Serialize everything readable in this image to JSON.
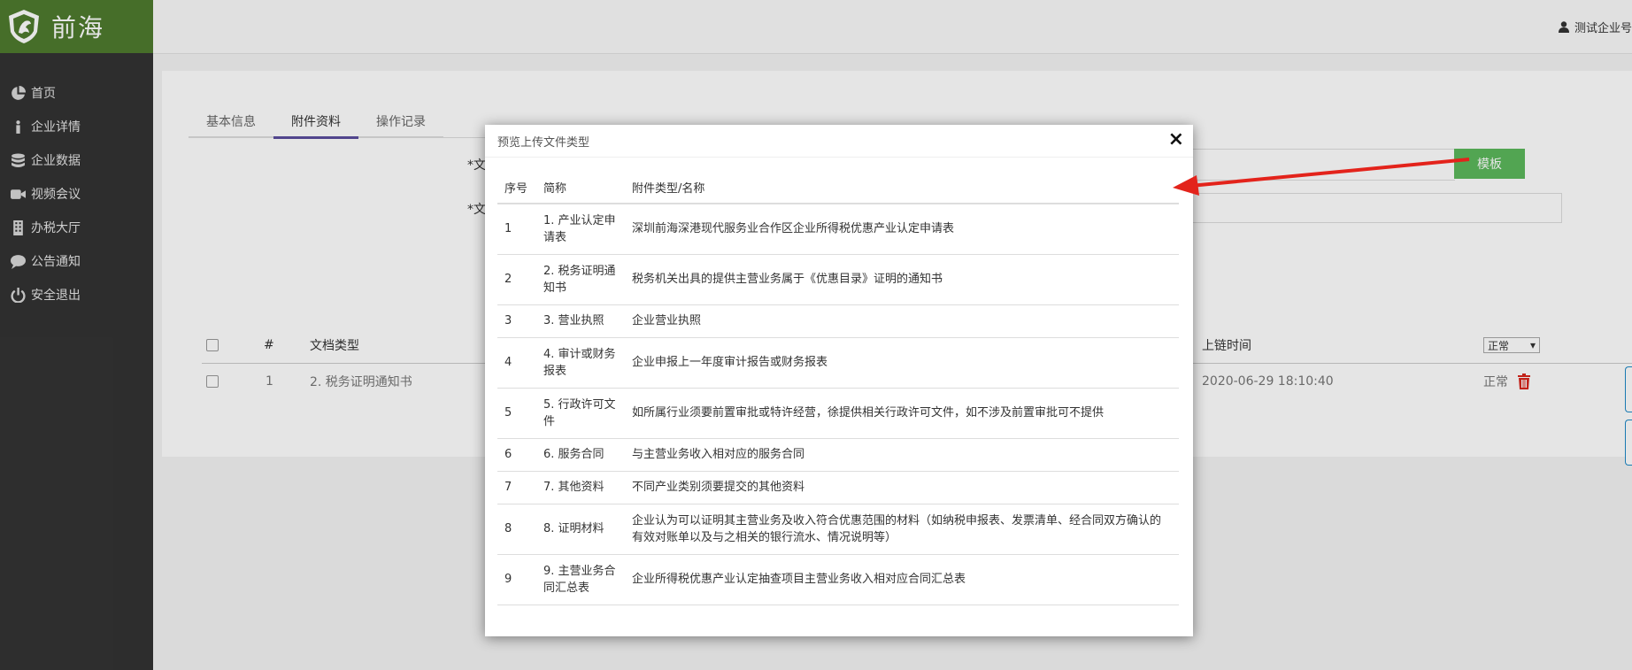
{
  "brand": {
    "name": "前海"
  },
  "sidebar": {
    "items": [
      {
        "label": "首页",
        "icon": "pie-chart-icon"
      },
      {
        "label": "企业详情",
        "icon": "info-icon"
      },
      {
        "label": "企业数据",
        "icon": "database-icon"
      },
      {
        "label": "视频会议",
        "icon": "video-camera-icon"
      },
      {
        "label": "办税大厅",
        "icon": "building-icon"
      },
      {
        "label": "公告通知",
        "icon": "comment-icon"
      },
      {
        "label": "安全退出",
        "icon": "power-icon"
      }
    ]
  },
  "topbar": {
    "user_label": "测试企业号"
  },
  "tabs": [
    {
      "label": "基本信息"
    },
    {
      "label": "附件资料"
    },
    {
      "label": "操作记录"
    }
  ],
  "form": {
    "label_1": "*文",
    "label_2": "*文",
    "template_button": "模板"
  },
  "table": {
    "headers": {
      "index": "#",
      "doc_type": "文档类型",
      "upload_time": "上链时间"
    },
    "status_filter": "正常",
    "rows": [
      {
        "index": "1",
        "doc_type": "2. 税务证明通知书",
        "upload_time": "2020-06-29 18:10:40",
        "status": "正常"
      }
    ]
  },
  "modal": {
    "title": "预览上传文件类型",
    "close": "×",
    "headers": {
      "no": "序号",
      "short": "简称",
      "name": "附件类型/名称"
    },
    "rows": [
      {
        "no": "1",
        "short": "1. 产业认定申请表",
        "name": "深圳前海深港现代服务业合作区企业所得税优惠产业认定申请表"
      },
      {
        "no": "2",
        "short": "2. 税务证明通知书",
        "name": "税务机关出具的提供主营业务属于《优惠目录》证明的通知书"
      },
      {
        "no": "3",
        "short": "3. 营业执照",
        "name": "企业营业执照"
      },
      {
        "no": "4",
        "short": "4. 审计或财务报表",
        "name": "企业申报上一年度审计报告或财务报表"
      },
      {
        "no": "5",
        "short": "5. 行政许可文件",
        "name": "如所属行业须要前置审批或特许经营，徐提供相关行政许可文件，如不涉及前置审批可不提供"
      },
      {
        "no": "6",
        "short": "6. 服务合同",
        "name": "与主营业务收入相对应的服务合同"
      },
      {
        "no": "7",
        "short": "7. 其他资料",
        "name": "不同产业类别须要提交的其他资料"
      },
      {
        "no": "8",
        "short": "8. 证明材料",
        "name": "企业认为可以证明其主营业务及收入符合优惠范围的材料（如纳税申报表、发票清单、经合同双方确认的有效对账单以及与之相关的银行流水、情况说明等）"
      },
      {
        "no": "9",
        "short": "9. 主营业务合同汇总表",
        "name": "企业所得税优惠产业认定抽查项目主营业务收入相对应合同汇总表"
      }
    ]
  },
  "colors": {
    "brand_green": "#4f7b2e",
    "sidebar_bg": "#333333",
    "button_green": "#5cb85c",
    "arrow_red": "#e3231b",
    "tab_active": "#5b4d9e"
  }
}
